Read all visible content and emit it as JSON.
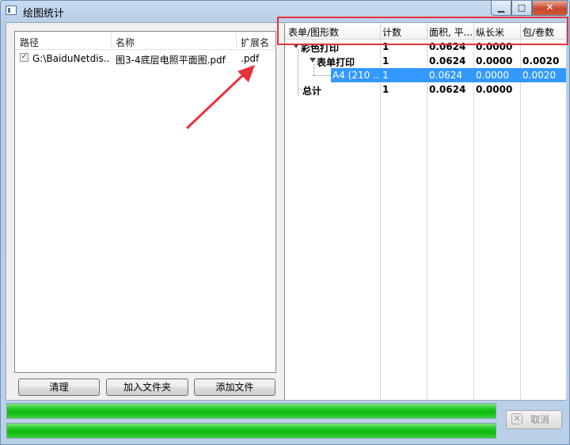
{
  "window": {
    "title": "绘图统计",
    "min_glyph": "▁",
    "max_glyph": "□",
    "close_glyph": "✕"
  },
  "file_list": {
    "headers": [
      "路径",
      "名称",
      "扩展名"
    ],
    "rows": [
      {
        "checked": true,
        "check_glyph": "✓",
        "path": "G:\\BaiduNetdis...",
        "name": "图3-4底层电照平面图.pdf",
        "ext": ".pdf"
      }
    ]
  },
  "buttons": {
    "clear": "清理",
    "add_folder": "加入文件夹",
    "add_file": "添加文件",
    "cancel": "取消",
    "cancel_glyph": "✕"
  },
  "tree": {
    "headers": [
      "表单/图形数",
      "计数",
      "面积, 平...",
      "纵长米",
      "包/卷数"
    ],
    "rows": [
      {
        "label": "彩色打印",
        "count": "1",
        "area": "0.0624",
        "length": "0.0000",
        "rolls": ""
      },
      {
        "label": "表单打印",
        "count": "1",
        "area": "0.0624",
        "length": "0.0000",
        "rolls": "0.0020"
      },
      {
        "label": "A4 (210 ...",
        "count": "1",
        "area": "0.0624",
        "length": "0.0000",
        "rolls": "0.0020"
      },
      {
        "label": "总计",
        "count": "1",
        "area": "0.0624",
        "length": "0.0000",
        "rolls": ""
      }
    ]
  },
  "progress": {
    "bar1": 100,
    "bar2": 100
  },
  "colors": {
    "highlight": "#e8323a",
    "arrow": "#e8323a",
    "progress": "#13c013",
    "selection": "#3399ff"
  }
}
